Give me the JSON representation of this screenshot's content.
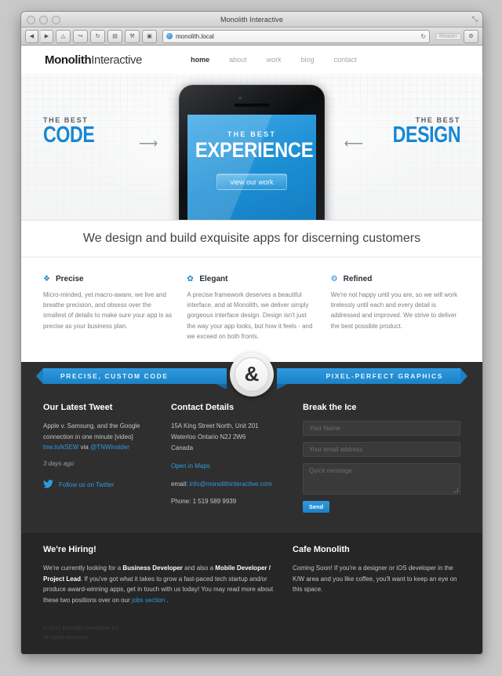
{
  "browser": {
    "window_title": "Monolith Interactive",
    "url": "monolith.local",
    "reader_label": "Reader",
    "reload_icon": "reload-icon",
    "back_icon": "◀",
    "forward_icon": "▶",
    "cloud_icon": "△",
    "share_icon": "↪",
    "refresh_icon": "↻",
    "reader_icon": "▤",
    "wrench_icon": "⚒",
    "sidebar_icon": "▣",
    "settings_icon": "⚙",
    "resize_icon": "⤡"
  },
  "header": {
    "logo_bold": "Monolith",
    "logo_light": "Interactive",
    "nav": [
      {
        "label": "home",
        "active": true
      },
      {
        "label": "about",
        "active": false
      },
      {
        "label": "work",
        "active": false
      },
      {
        "label": "blog",
        "active": false
      },
      {
        "label": "contact",
        "active": false
      }
    ]
  },
  "hero": {
    "left": {
      "kicker": "THE BEST",
      "word": "CODE"
    },
    "right": {
      "kicker": "THE BEST",
      "word": "DESIGN"
    },
    "arrow_left": "⟶",
    "arrow_right": "⟵",
    "phone": {
      "kicker": "THE BEST",
      "title": "EXPERIENCE",
      "button": "view our work"
    }
  },
  "tagline": "We design and build exquisite apps for discerning customers",
  "features": [
    {
      "icon": "compass-icon",
      "glyph": "❖",
      "title": "Precise",
      "body": "Micro-minded, yet macro-aware, we live and breathe precision, and obsess over the smallest of details to make sure your app is as precise as your business plan."
    },
    {
      "icon": "leaf-icon",
      "glyph": "✿",
      "title": "Elegant",
      "body": "A precise framework deserves a beautiful interface, and at Monolith, we deliver simply gorgeous interface design. Design isn't just the way your app looks, but how it feels - and we exceed on both fronts."
    },
    {
      "icon": "gear-icon",
      "glyph": "⚙",
      "title": "Refined",
      "body": "We're not happy until you are, so we will work tirelessly until each and every detail is addressed and improved. We strive to deliver the best possible product."
    }
  ],
  "ribbon": {
    "left": "PRECISE, CUSTOM CODE",
    "right": "PIXEL-PERFECT GRAPHICS",
    "badge": "&"
  },
  "footer": {
    "tweet": {
      "heading": "Our Latest Tweet",
      "text": "Apple v. Samsung, and the Google connection in one minute [video]",
      "link": "tnw.to/kSEW",
      "via": "via",
      "handle": "@TNWinsider",
      "date": "3 days ago",
      "follow": "Follow us on Twitter",
      "bird_icon": "twitter-bird-icon",
      "bird_glyph": "ὂ6"
    },
    "contact": {
      "heading": "Contact Details",
      "address_line1": "15A King Street North, Unit 201",
      "address_line2": "Waterloo Ontario N2J 2W6",
      "address_line3": "Canada",
      "maps_link": "Open in Maps",
      "email_label": "email:",
      "email": "info@monolithinteractive.com",
      "phone": "Phone: 1 519 589 9939"
    },
    "form": {
      "heading": "Break the Ice",
      "name_placeholder": "Your Name",
      "email_placeholder": "Your email address",
      "message_placeholder": "Quick message",
      "send_label": "Send"
    },
    "hiring": {
      "heading": "We're Hiring!",
      "p1": "We're currently looking for a ",
      "role1": "Business Developer",
      "p2": " and also a ",
      "role2": "Mobile Developer / Project Lead",
      "p3": ". If you've got what it takes to grow a fast-paced tech startup and/or produce award-winning apps, get in touch with us today! You may read more about these two positions over on our ",
      "link": "jobs section",
      "p4": " ."
    },
    "cafe": {
      "heading": "Cafe Monolith",
      "body": "Coming Soon! If you're a designer or iOS developer in the K/W area and you like coffee, you'll want to keep an eye on this space."
    },
    "copyright_line1": "© 2012 Monolith Interactive Inc",
    "copyright_line2": "All rights reserved."
  }
}
